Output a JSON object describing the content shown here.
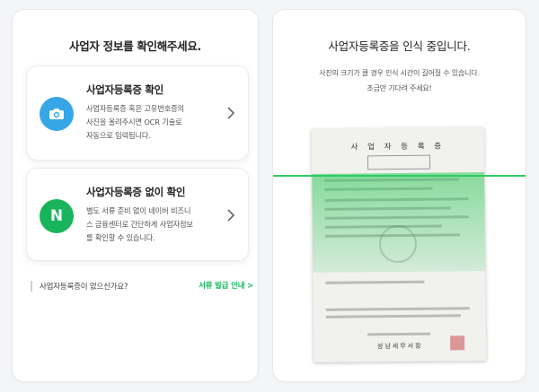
{
  "left_panel": {
    "title": "사업자 정보를 확인해주세요.",
    "cards": [
      {
        "title": "사업자등록증 확인",
        "description_lines": [
          "사업자등록증 혹은 고유번호증의",
          "사진을 올려주시면 OCR 기술로",
          "자동으로 입력됩니다."
        ],
        "icon": "camera-icon",
        "icon_color": "#35a7e6"
      },
      {
        "title": "사업자등록증 없이 확인",
        "description_lines": [
          "별도 서류 준비 없이 네이버 비즈니",
          "스 금융센터로 간단하게 사업자정보",
          "를 확인할 수 있습니다."
        ],
        "icon": "naver-n-icon",
        "icon_letter": "N",
        "icon_color": "#18b45c"
      }
    ],
    "footer": {
      "question": "사업자등록증이 없으신가요?",
      "link": "서류 발급 안내 >"
    }
  },
  "right_panel": {
    "title": "사업자등록증을 인식 중입니다.",
    "subtitle_lines": [
      "사진의 크기가 클 경우 인식 시간이 길어질 수 있습니다.",
      "조금만 기다려 주세요!"
    ],
    "document": {
      "title": "사 업 자 등 록 증",
      "office": "성남세무서장"
    },
    "scan_color": "#2fcb63"
  },
  "accent_color": "#17b85e"
}
